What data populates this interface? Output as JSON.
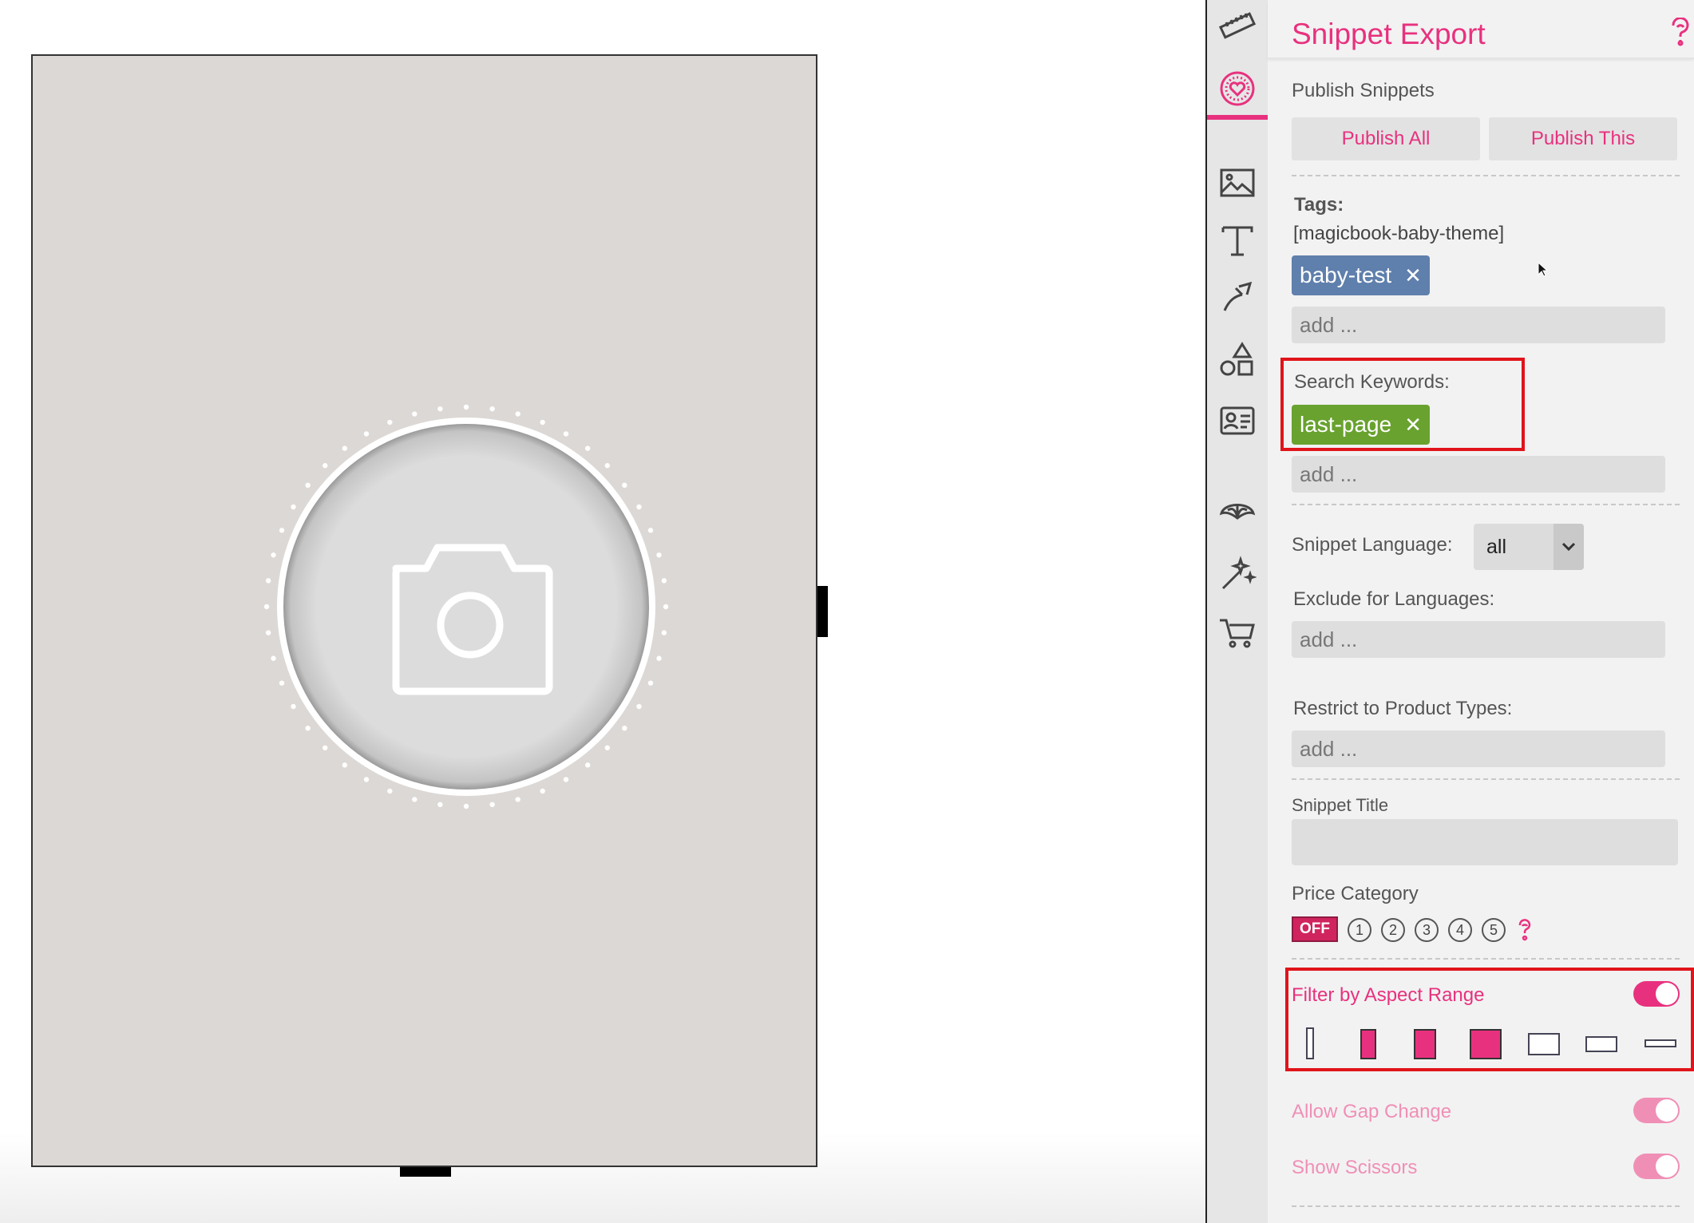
{
  "canvas": {
    "page_background": "#dcd8d5",
    "placeholder_icon": "camera-icon"
  },
  "rail": {
    "icons": [
      "ruler-icon",
      "snippet-heart-icon",
      "image-icon",
      "text-icon",
      "brush-icon",
      "shapes-icon",
      "contact-card-icon",
      "umbrella-icon",
      "magic-wand-icon",
      "cart-icon"
    ],
    "active": "snippet-heart-icon"
  },
  "panel": {
    "title": "Snippet Export",
    "help_icon": "help-icon",
    "publish": {
      "heading": "Publish Snippets",
      "publish_all": "Publish All",
      "publish_this": "Publish This"
    },
    "tags": {
      "label": "Tags:",
      "theme": "[magicbook-baby-theme]",
      "chip": "baby-test",
      "chip_color": "#5f7fac",
      "placeholder": "add ..."
    },
    "keywords": {
      "label": "Search Keywords:",
      "chip": "last-page",
      "chip_color": "#69a22f",
      "placeholder": "add ..."
    },
    "language": {
      "label": "Snippet Language:",
      "value": "all"
    },
    "exclude": {
      "label": "Exclude for Languages:",
      "placeholder": "add ..."
    },
    "restrict": {
      "label": "Restrict to Product Types:",
      "placeholder": "add ..."
    },
    "snippet_title": {
      "label": "Snippet Title",
      "value": ""
    },
    "price": {
      "label": "Price Category",
      "off": "OFF",
      "options": [
        "1",
        "2",
        "3",
        "4",
        "5"
      ]
    },
    "aspect": {
      "label": "Filter by Aspect Range",
      "enabled": true,
      "states": [
        false,
        true,
        true,
        true,
        false,
        false,
        false
      ]
    },
    "allow_gap": {
      "label": "Allow Gap Change",
      "enabled": true
    },
    "scissors": {
      "label": "Show Scissors",
      "enabled": true
    },
    "accent": "#e8317e",
    "highlight": "#e0141a"
  }
}
